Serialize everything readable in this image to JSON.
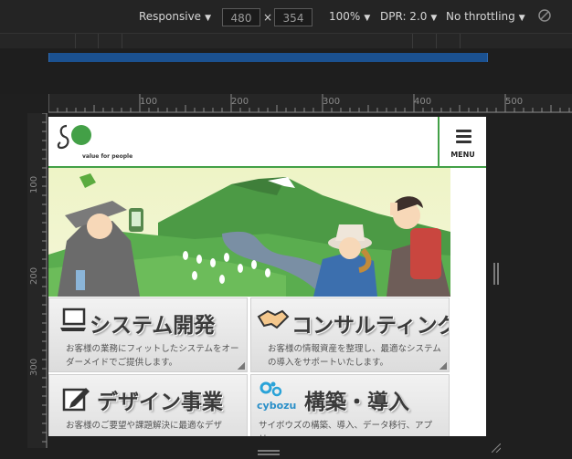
{
  "toolbar": {
    "device": "Responsive",
    "width": "480",
    "times": "×",
    "height": "354",
    "zoom": "100%",
    "dpr": "DPR: 2.0",
    "throttle": "No throttling"
  },
  "ruler": {
    "top_labels": [
      "100",
      "200",
      "300",
      "400",
      "500"
    ],
    "left_labels": [
      "100",
      "200",
      "300"
    ]
  },
  "site": {
    "logo_text": "value for people",
    "menu_label": "MENU",
    "tiles": [
      {
        "title": "システム開発",
        "desc": "お客様の業務にフィットしたシステムをオーダーメイドでご提供します。"
      },
      {
        "title": "コンサルティング",
        "desc": "お客様の情報資産を整理し、最適なシステムの導入をサポートいたします。"
      },
      {
        "title": "デザイン事業",
        "desc": "お客様のご要望や課題解決に最適なデザ"
      },
      {
        "title": "構築・導入",
        "logo": "cybozu",
        "desc": "サイボウズの構築、導入、データ移行、アプリ"
      }
    ]
  },
  "colors": {
    "accent_green": "#43a047",
    "media_bar": "#1b5190",
    "toolbar_bg": "#242424"
  }
}
